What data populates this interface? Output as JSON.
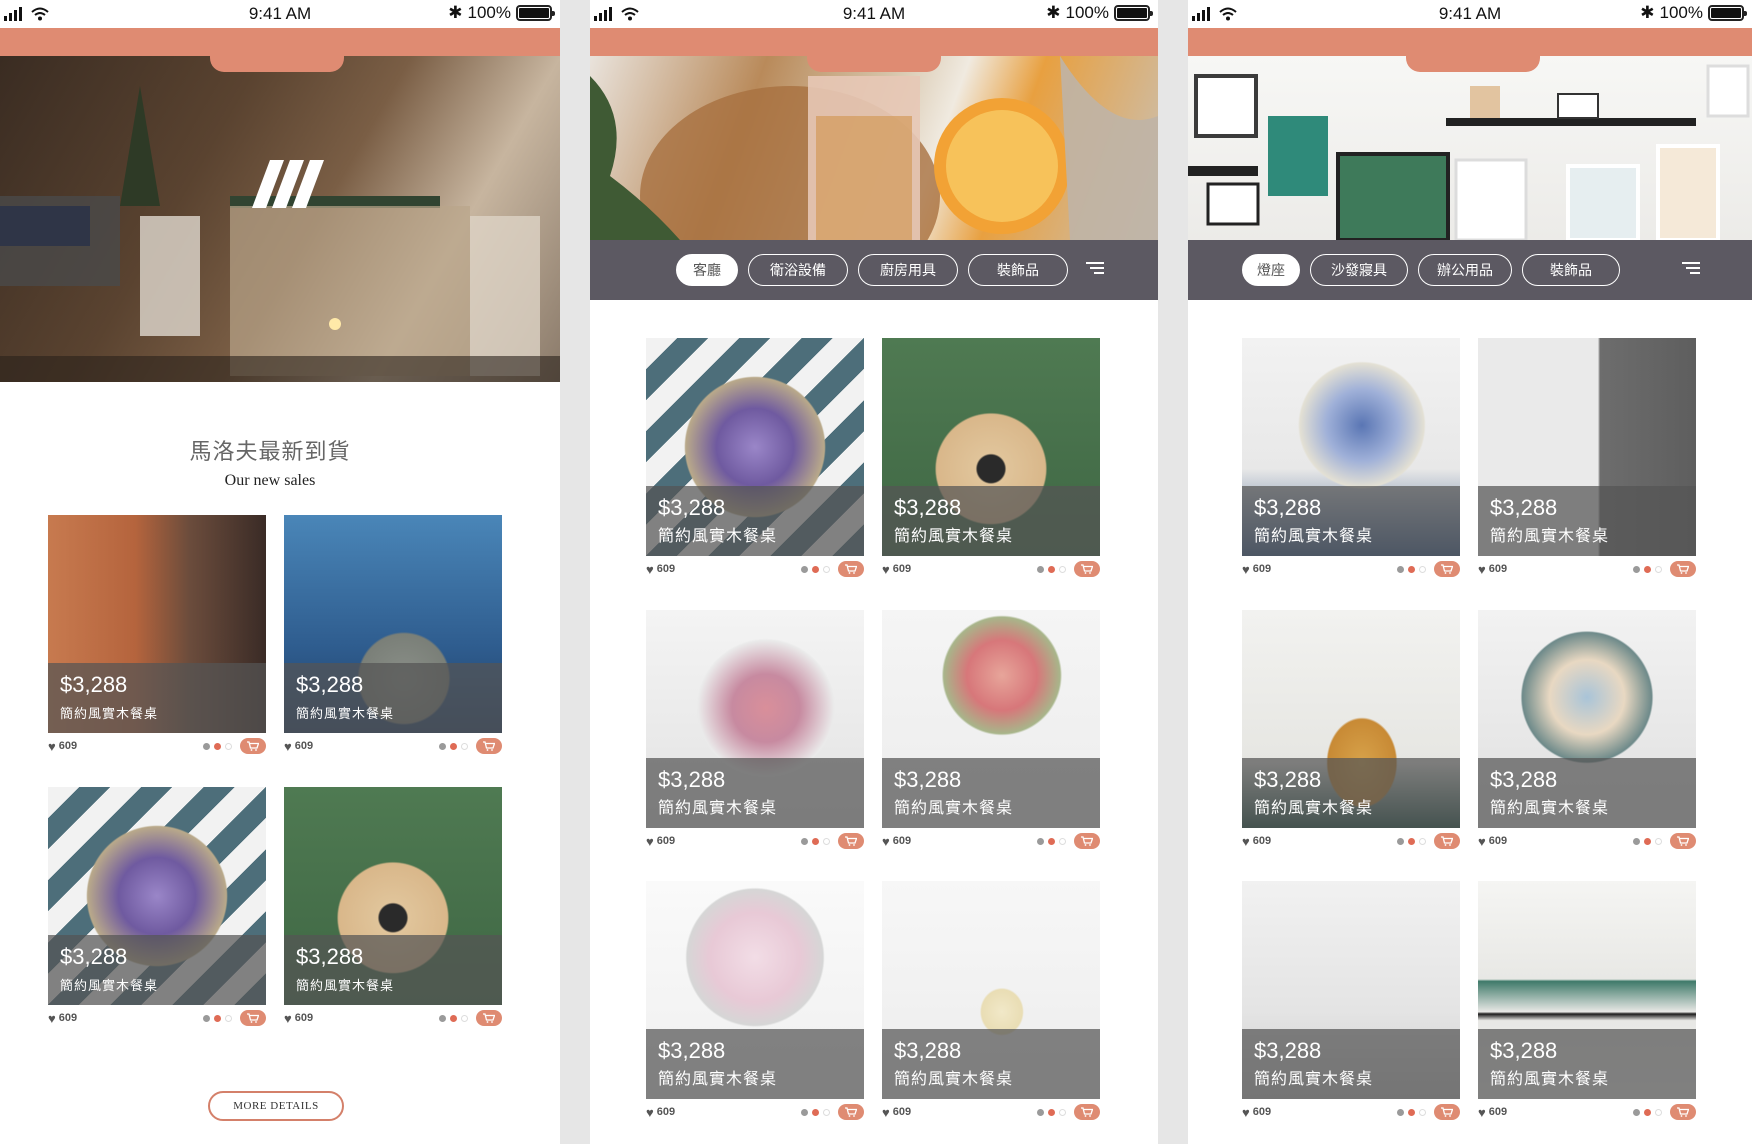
{
  "status_bar": {
    "time": "9:41 AM",
    "battery": "100%"
  },
  "screen1": {
    "logo": "M",
    "heading_zh": "馬洛夫最新到貨",
    "heading_en": "Our new sales",
    "more_button": "MORE DETAILS",
    "products": [
      {
        "price": "$3,288",
        "name": "簡約風實木餐桌",
        "likes": "609",
        "image": "pendant-lamps"
      },
      {
        "price": "$3,288",
        "name": "簡約風實木餐桌",
        "likes": "609",
        "image": "incense-holder"
      },
      {
        "price": "$3,288",
        "name": "簡約風實木餐桌",
        "likes": "609",
        "image": "glass-terrarium"
      },
      {
        "price": "$3,288",
        "name": "簡約風實木餐桌",
        "likes": "609",
        "image": "diffuser-bottle"
      }
    ]
  },
  "screen2": {
    "categories": [
      {
        "label": "客廳",
        "active": true
      },
      {
        "label": "衛浴設備"
      },
      {
        "label": "廚房用具"
      },
      {
        "label": "裝飾品"
      }
    ],
    "products": [
      {
        "price": "$3,288",
        "name": "簡約風實木餐桌",
        "likes": "609",
        "image": "glass-terrarium"
      },
      {
        "price": "$3,288",
        "name": "簡約風實木餐桌",
        "likes": "609",
        "image": "diffuser-bottle"
      },
      {
        "price": "$3,288",
        "name": "簡約風實木餐桌",
        "likes": "609",
        "image": "glass-dome-roses"
      },
      {
        "price": "$3,288",
        "name": "簡約風實木餐桌",
        "likes": "609",
        "image": "rose-vase"
      },
      {
        "price": "$3,288",
        "name": "簡約風實木餐桌",
        "likes": "609",
        "image": "white-peonies"
      },
      {
        "price": "$3,288",
        "name": "簡約風實木餐桌",
        "likes": "609",
        "image": "scented-candle"
      }
    ]
  },
  "screen3": {
    "categories": [
      {
        "label": "燈座",
        "active": true
      },
      {
        "label": "沙發寢具"
      },
      {
        "label": "辦公用品"
      },
      {
        "label": "裝飾品"
      }
    ],
    "products": [
      {
        "price": "$3,288",
        "name": "簡約風實木餐桌",
        "likes": "609",
        "image": "blue-bouquet"
      },
      {
        "price": "$3,288",
        "name": "簡約風實木餐桌",
        "likes": "609",
        "image": "dried-grass-cabinet"
      },
      {
        "price": "$3,288",
        "name": "簡約風實木餐桌",
        "likes": "609",
        "image": "wall-frames-plant"
      },
      {
        "price": "$3,288",
        "name": "簡約風實木餐桌",
        "likes": "609",
        "image": "pastel-bouquet"
      },
      {
        "price": "$3,288",
        "name": "簡約風實木餐桌",
        "likes": "609",
        "image": "kids-room"
      },
      {
        "price": "$3,288",
        "name": "簡約風實木餐桌",
        "likes": "609",
        "image": "shelf-frames"
      }
    ]
  },
  "colors": {
    "accent": "#df8b72",
    "category_bar": "#5c5962",
    "overlay": "#555555",
    "dot_gray": "#9a9a9a",
    "dot_red": "#df6b55",
    "dot_white": "#ffffff"
  }
}
